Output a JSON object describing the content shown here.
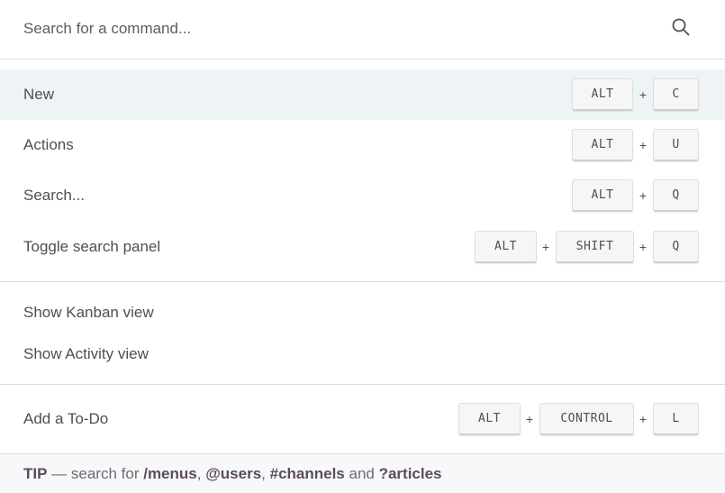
{
  "search": {
    "placeholder": "Search for a command...",
    "icon": "search-icon"
  },
  "groups": [
    {
      "commands": [
        {
          "label": "New",
          "active": true,
          "keys": [
            "ALT",
            "C"
          ]
        },
        {
          "label": "Actions",
          "keys": [
            "ALT",
            "U"
          ]
        },
        {
          "label": "Search...",
          "keys": [
            "ALT",
            "Q"
          ]
        },
        {
          "label": "Toggle search panel",
          "keys": [
            "ALT",
            "SHIFT",
            "Q"
          ]
        }
      ]
    },
    {
      "commands": [
        {
          "label": "Show Kanban view",
          "keys": []
        },
        {
          "label": "Show Activity view",
          "keys": []
        }
      ]
    },
    {
      "commands": [
        {
          "label": "Add a To-Do",
          "keys": [
            "ALT",
            "CONTROL",
            "L"
          ]
        }
      ]
    }
  ],
  "key_separator": "+",
  "tip": {
    "label": "TIP",
    "dash": " — search for ",
    "menus": "/menus",
    "sep1": ", ",
    "users": "@users",
    "sep2": ", ",
    "channels": "#channels",
    "and": " and ",
    "articles": "?articles"
  },
  "colors": {
    "active_row": "#eef3f5",
    "tip_accent": "#5d4c5f",
    "divider": "#dcdcdc"
  }
}
